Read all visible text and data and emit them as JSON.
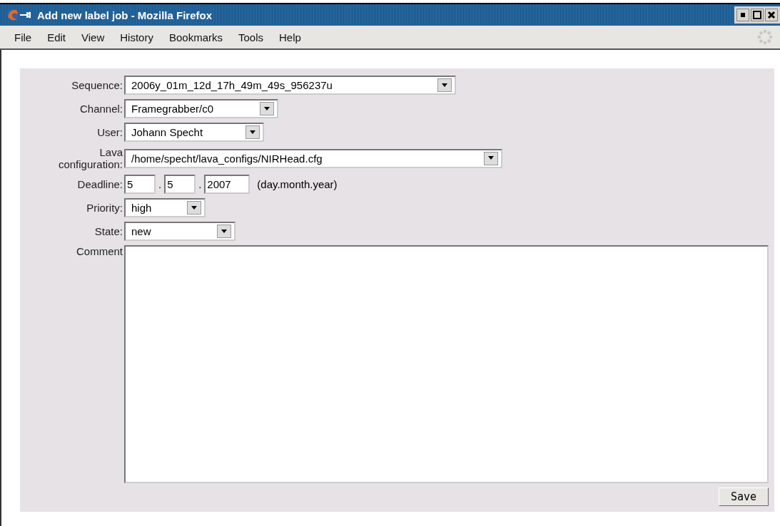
{
  "window": {
    "title": "Add new label job - Mozilla Firefox"
  },
  "menu": [
    "File",
    "Edit",
    "View",
    "History",
    "Bookmarks",
    "Tools",
    "Help"
  ],
  "form": {
    "fields": [
      {
        "kind": "select",
        "label": "Sequence:",
        "value": "2006y_01m_12d_17h_49m_49s_956237u"
      },
      {
        "kind": "select",
        "label": "Channel:",
        "value": "Framegrabber/c0"
      },
      {
        "kind": "select",
        "label": "User:",
        "value": "Johann Specht"
      },
      {
        "kind": "select",
        "label": "Lava configuration:",
        "value": "/home/specht/lava_configs/NIRHead.cfg"
      },
      {
        "kind": "date",
        "label": "Deadline:",
        "day": "5",
        "separator_1": ".",
        "month": "5",
        "separator_2": ".",
        "year": "2007",
        "hint": "(day.month.year)"
      },
      {
        "kind": "select",
        "label": "Priority:",
        "value": "high"
      },
      {
        "kind": "select",
        "label": "State:",
        "value": "new"
      },
      {
        "kind": "textarea",
        "label": "Comment"
      }
    ],
    "save_button": "Save"
  }
}
